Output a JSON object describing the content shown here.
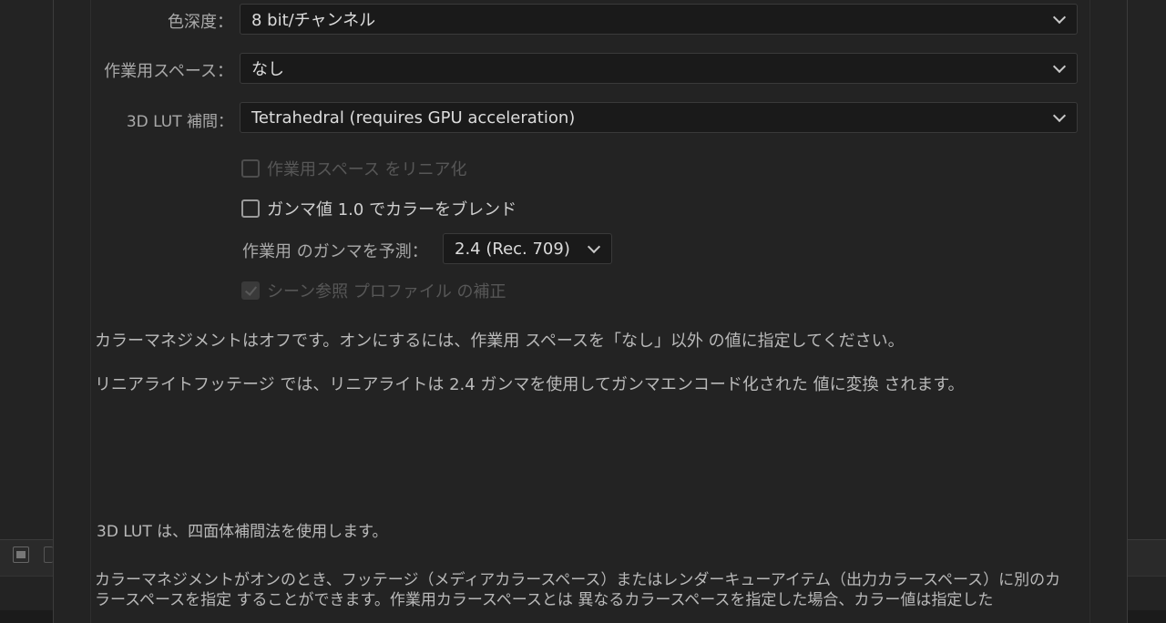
{
  "fields": {
    "depth_label": "色深度：",
    "depth_value": "8 bit/チャンネル",
    "working_space_label": "作業用スペース：",
    "working_space_value": "なし",
    "lut_label": "3D LUT 補間：",
    "lut_value": "Tetrahedral (requires GPU acceleration)",
    "gamma_label": "作業用 のガンマを予測：",
    "gamma_value": "2.4 (Rec. 709)"
  },
  "checkboxes": {
    "linearize_label": "作業用スペース をリニア化",
    "linearize_checked": false,
    "blend_label": "ガンマ値 1.0 でカラーをブレンド",
    "blend_checked": false,
    "scene_label": "シーン参照 プロファイル の補正",
    "scene_checked": true
  },
  "info": {
    "line1": "カラーマネジメントはオフです。オンにするには、作業用 スペースを「なし」以外 の値に指定してください。",
    "line2": "リニアライトフッテージ では、リニアライトは 2.4 ガンマを使用してガンマエンコード化された 値に変換 されます。",
    "line3": "3D LUT は、四面体補間法を使用します。",
    "line4": "カラーマネジメントがオンのとき、フッテージ（メディアカラースペース）またはレンダーキューアイテム（出力カラースペース）に別のカ",
    "line5": "ラースペースを指定 することができます。作業用カラースペースとは 異なるカラースペースを指定した場合、カラー値は指定した"
  },
  "colors": {
    "background": "#232323",
    "field_bg": "#1a1a1a",
    "text": "#b9b9b9"
  }
}
